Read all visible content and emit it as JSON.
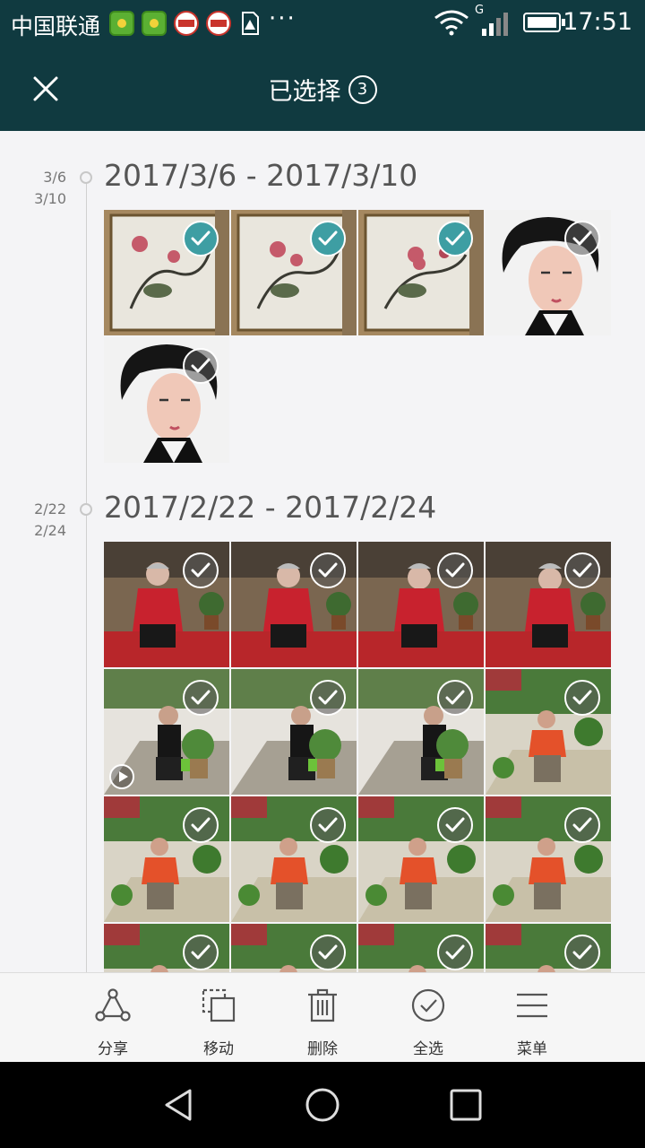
{
  "status_bar": {
    "carrier": "中国联通",
    "network": "G",
    "time": "17:51",
    "icons": [
      "app-green-icon",
      "app-green-icon",
      "toutiao-icon",
      "toutiao-icon",
      "sim-alert-icon",
      "more-dots-icon",
      "wifi-icon",
      "signal-icon",
      "battery-icon"
    ]
  },
  "app_bar": {
    "title": "已选择",
    "selected_count": "3",
    "close_icon": "close-icon"
  },
  "sections": [
    {
      "date_start": "3/6",
      "date_end": "3/10",
      "title": "2017/3/6 - 2017/3/10",
      "photos": [
        {
          "subject": "painting",
          "selected": true
        },
        {
          "subject": "painting",
          "selected": true
        },
        {
          "subject": "painting",
          "selected": true
        },
        {
          "subject": "portrait",
          "selected": false
        },
        {
          "subject": "portrait",
          "selected": false
        }
      ]
    },
    {
      "date_start": "2/22",
      "date_end": "2/24",
      "title": "2017/2/22 - 2017/2/24",
      "photos": [
        {
          "subject": "elder-red",
          "selected": false
        },
        {
          "subject": "elder-red",
          "selected": false
        },
        {
          "subject": "elder-red",
          "selected": false
        },
        {
          "subject": "elder-red",
          "selected": false
        },
        {
          "subject": "man-plants",
          "selected": false,
          "video": true
        },
        {
          "subject": "man-plants",
          "selected": false
        },
        {
          "subject": "man-plants",
          "selected": false
        },
        {
          "subject": "woman-orange",
          "selected": false
        },
        {
          "subject": "woman-orange",
          "selected": false
        },
        {
          "subject": "woman-orange",
          "selected": false
        },
        {
          "subject": "woman-orange",
          "selected": false
        },
        {
          "subject": "woman-orange",
          "selected": false
        },
        {
          "subject": "woman-orange",
          "selected": false
        },
        {
          "subject": "woman-orange",
          "selected": false
        },
        {
          "subject": "woman-orange",
          "selected": false
        },
        {
          "subject": "woman-orange",
          "selected": false
        }
      ]
    }
  ],
  "toolbar": {
    "share_label": "分享",
    "move_label": "移动",
    "delete_label": "删除",
    "select_all_label": "全选",
    "menu_label": "菜单"
  },
  "colors": {
    "app_bar": "#103a40",
    "selected_check": "#3e9ea3"
  }
}
